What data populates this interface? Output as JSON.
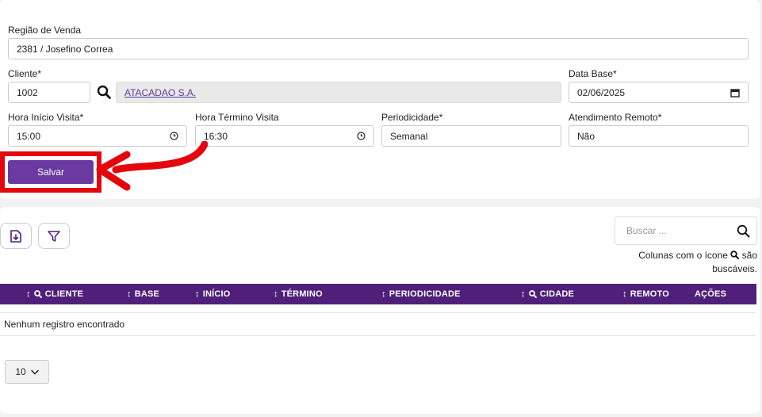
{
  "form": {
    "regiao": {
      "label": "Região de Venda",
      "value": "2381 / Josefino Correa"
    },
    "cliente": {
      "label": "Cliente*",
      "code": "1002",
      "name": "ATACADAO S.A."
    },
    "data_base": {
      "label": "Data Base*",
      "value": "02/06/2025"
    },
    "hora_inicio": {
      "label": "Hora Início Visita*",
      "value": "15:00"
    },
    "hora_termino": {
      "label": "Hora Término Visita",
      "value": "16:30"
    },
    "periodicidade": {
      "label": "Periodicidade*",
      "value": "Semanal"
    },
    "atendimento": {
      "label": "Atendimento Remoto*",
      "value": "Não"
    },
    "save_label": "Salvar"
  },
  "annotation": {
    "color": "#e4060c"
  },
  "list": {
    "search_placeholder": "Buscar ...",
    "search_hint_prefix": "Colunas com o ícone",
    "search_hint_suffix": "são buscáveis.",
    "columns": [
      {
        "label": "CLIENTE",
        "sortable": true,
        "searchable": true
      },
      {
        "label": "BASE",
        "sortable": true,
        "searchable": false
      },
      {
        "label": "INÍCIO",
        "sortable": true,
        "searchable": false
      },
      {
        "label": "TÉRMINO",
        "sortable": true,
        "searchable": false
      },
      {
        "label": "PERIODICIDADE",
        "sortable": true,
        "searchable": false
      },
      {
        "label": "CIDADE",
        "sortable": true,
        "searchable": true
      },
      {
        "label": "REMOTO",
        "sortable": true,
        "searchable": false
      },
      {
        "label": "AÇÕES",
        "sortable": false,
        "searchable": false
      }
    ],
    "empty_message": "Nenhum registro encontrado",
    "page_size": "10"
  },
  "colors": {
    "accent": "#6a3aa0",
    "header_bg": "#4f1f7a"
  },
  "icons": [
    "search-icon",
    "clock-icon",
    "calendar-icon",
    "export-icon",
    "filter-icon",
    "chevron-down-icon",
    "sort-icon"
  ]
}
